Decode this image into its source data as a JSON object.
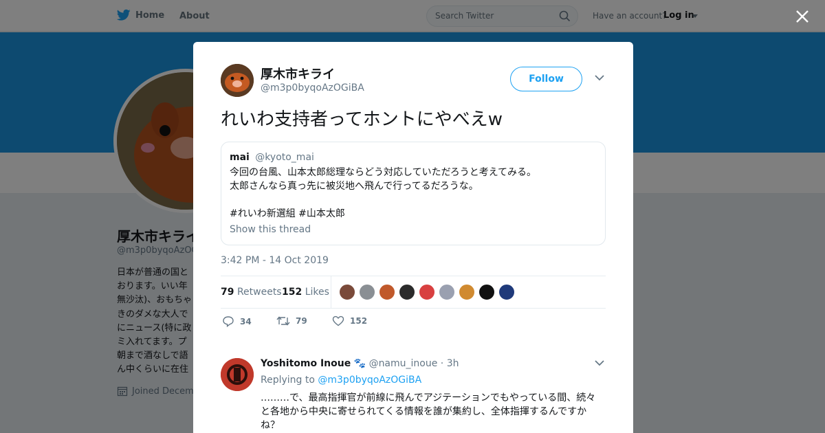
{
  "nav": {
    "home_label": "Home",
    "about_label": "About",
    "search_placeholder": "Search Twitter",
    "account_prompt": "Have an account?",
    "login_label": "Log in"
  },
  "profile": {
    "name": "厚木市キライ",
    "handle": "@m3p0byqoAzOGiBA",
    "bio": "日本が普通の国と\nおります。いい年\n無沙汰)、おもちゃ\nきのダメな大人で\nにニュース(特に政\nミ入れてます。プ\n朝まで酒なしで語\nん中くらいに在住",
    "joined": "Joined Decem"
  },
  "tweet": {
    "author_name": "厚木市キライ",
    "author_handle": "@m3p0byqoAzOGiBA",
    "follow_label": "Follow",
    "text": "れいわ支持者ってホントにやべえw",
    "timestamp": "3:42 PM - 14 Oct 2019",
    "retweets_count": "79",
    "retweets_label": "Retweets",
    "likes_count": "152",
    "likes_label": "Likes",
    "reply_action_count": "34",
    "retweet_action_count": "79",
    "like_action_count": "152"
  },
  "quoted": {
    "name": "mai",
    "handle": "@kyoto_mai",
    "body": "今回の台風、山本太郎総理ならどう対応していただろうと考えてみる。\n太郎さんなら真っ先に被災地へ飛んで行ってるだろうな。\n\n#れいわ新選組 #山本太郎",
    "thread_label": "Show this thread"
  },
  "reply": {
    "name": "Yoshitomo Inoue",
    "emoji": "🐾",
    "handle": "@namu_inoue",
    "time": "· 3h",
    "replying_prefix": "Replying to",
    "replying_handle": "@m3p0byqoAzOGiBA",
    "text": "………で、最高指揮官が前線に飛んでアジテーションでもやっている間、続々と各地から中央に寄せられてくる情報を誰が集約し、全体指揮するんですかね？"
  },
  "liker_colors": [
    "#7a4a3a",
    "#8a8f94",
    "#c0592b",
    "#2b2b2b",
    "#d84040",
    "#9aa0b0",
    "#d08a30",
    "#111111",
    "#1f3a7a"
  ],
  "colors": {
    "accent": "#1da1f2",
    "banner": "#1b95e0"
  }
}
